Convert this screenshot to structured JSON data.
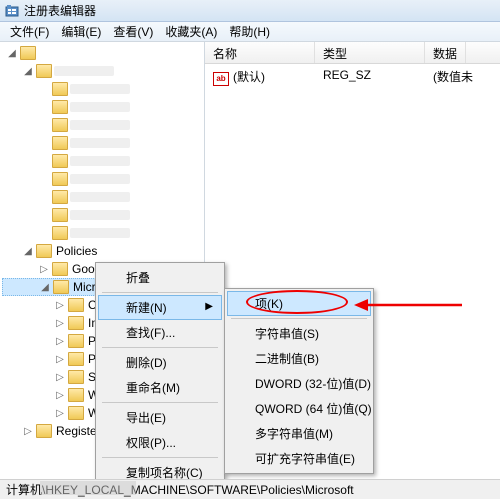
{
  "window": {
    "title": "注册表编辑器"
  },
  "menubar": {
    "file": "文件(F)",
    "edit": "编辑(E)",
    "view": "查看(V)",
    "favorites": "收藏夹(A)",
    "help": "帮助(H)"
  },
  "list": {
    "columns": {
      "name": "名称",
      "type": "类型",
      "data": "数据"
    },
    "rows": [
      {
        "icon": "ab",
        "name": "(默认)",
        "type": "REG_SZ",
        "data": "(数值未"
      }
    ]
  },
  "tree": {
    "policies": "Policies",
    "google": "Google",
    "microsoft": "Micros",
    "children": {
      "c0": "Cr",
      "c1": "In",
      "c2": "Pe",
      "c3": "Pe",
      "c4": "Sy",
      "c5": "W",
      "c6": "W"
    },
    "registered": "Register"
  },
  "context1": {
    "collapse": "折叠",
    "new": "新建(N)",
    "find": "查找(F)...",
    "delete": "删除(D)",
    "rename": "重命名(M)",
    "export": "导出(E)",
    "permissions": "权限(P)...",
    "copykey": "复制项名称(C)"
  },
  "context2": {
    "key": "项(K)",
    "string": "字符串值(S)",
    "binary": "二进制值(B)",
    "dword": "DWORD (32-位)值(D)",
    "qword": "QWORD (64 位)值(Q)",
    "multi": "多字符串值(M)",
    "expand": "可扩充字符串值(E)"
  },
  "statusbar": {
    "path": "计算机\\HKEY_LOCAL_MACHINE\\SOFTWARE\\Policies\\Microsoft"
  }
}
